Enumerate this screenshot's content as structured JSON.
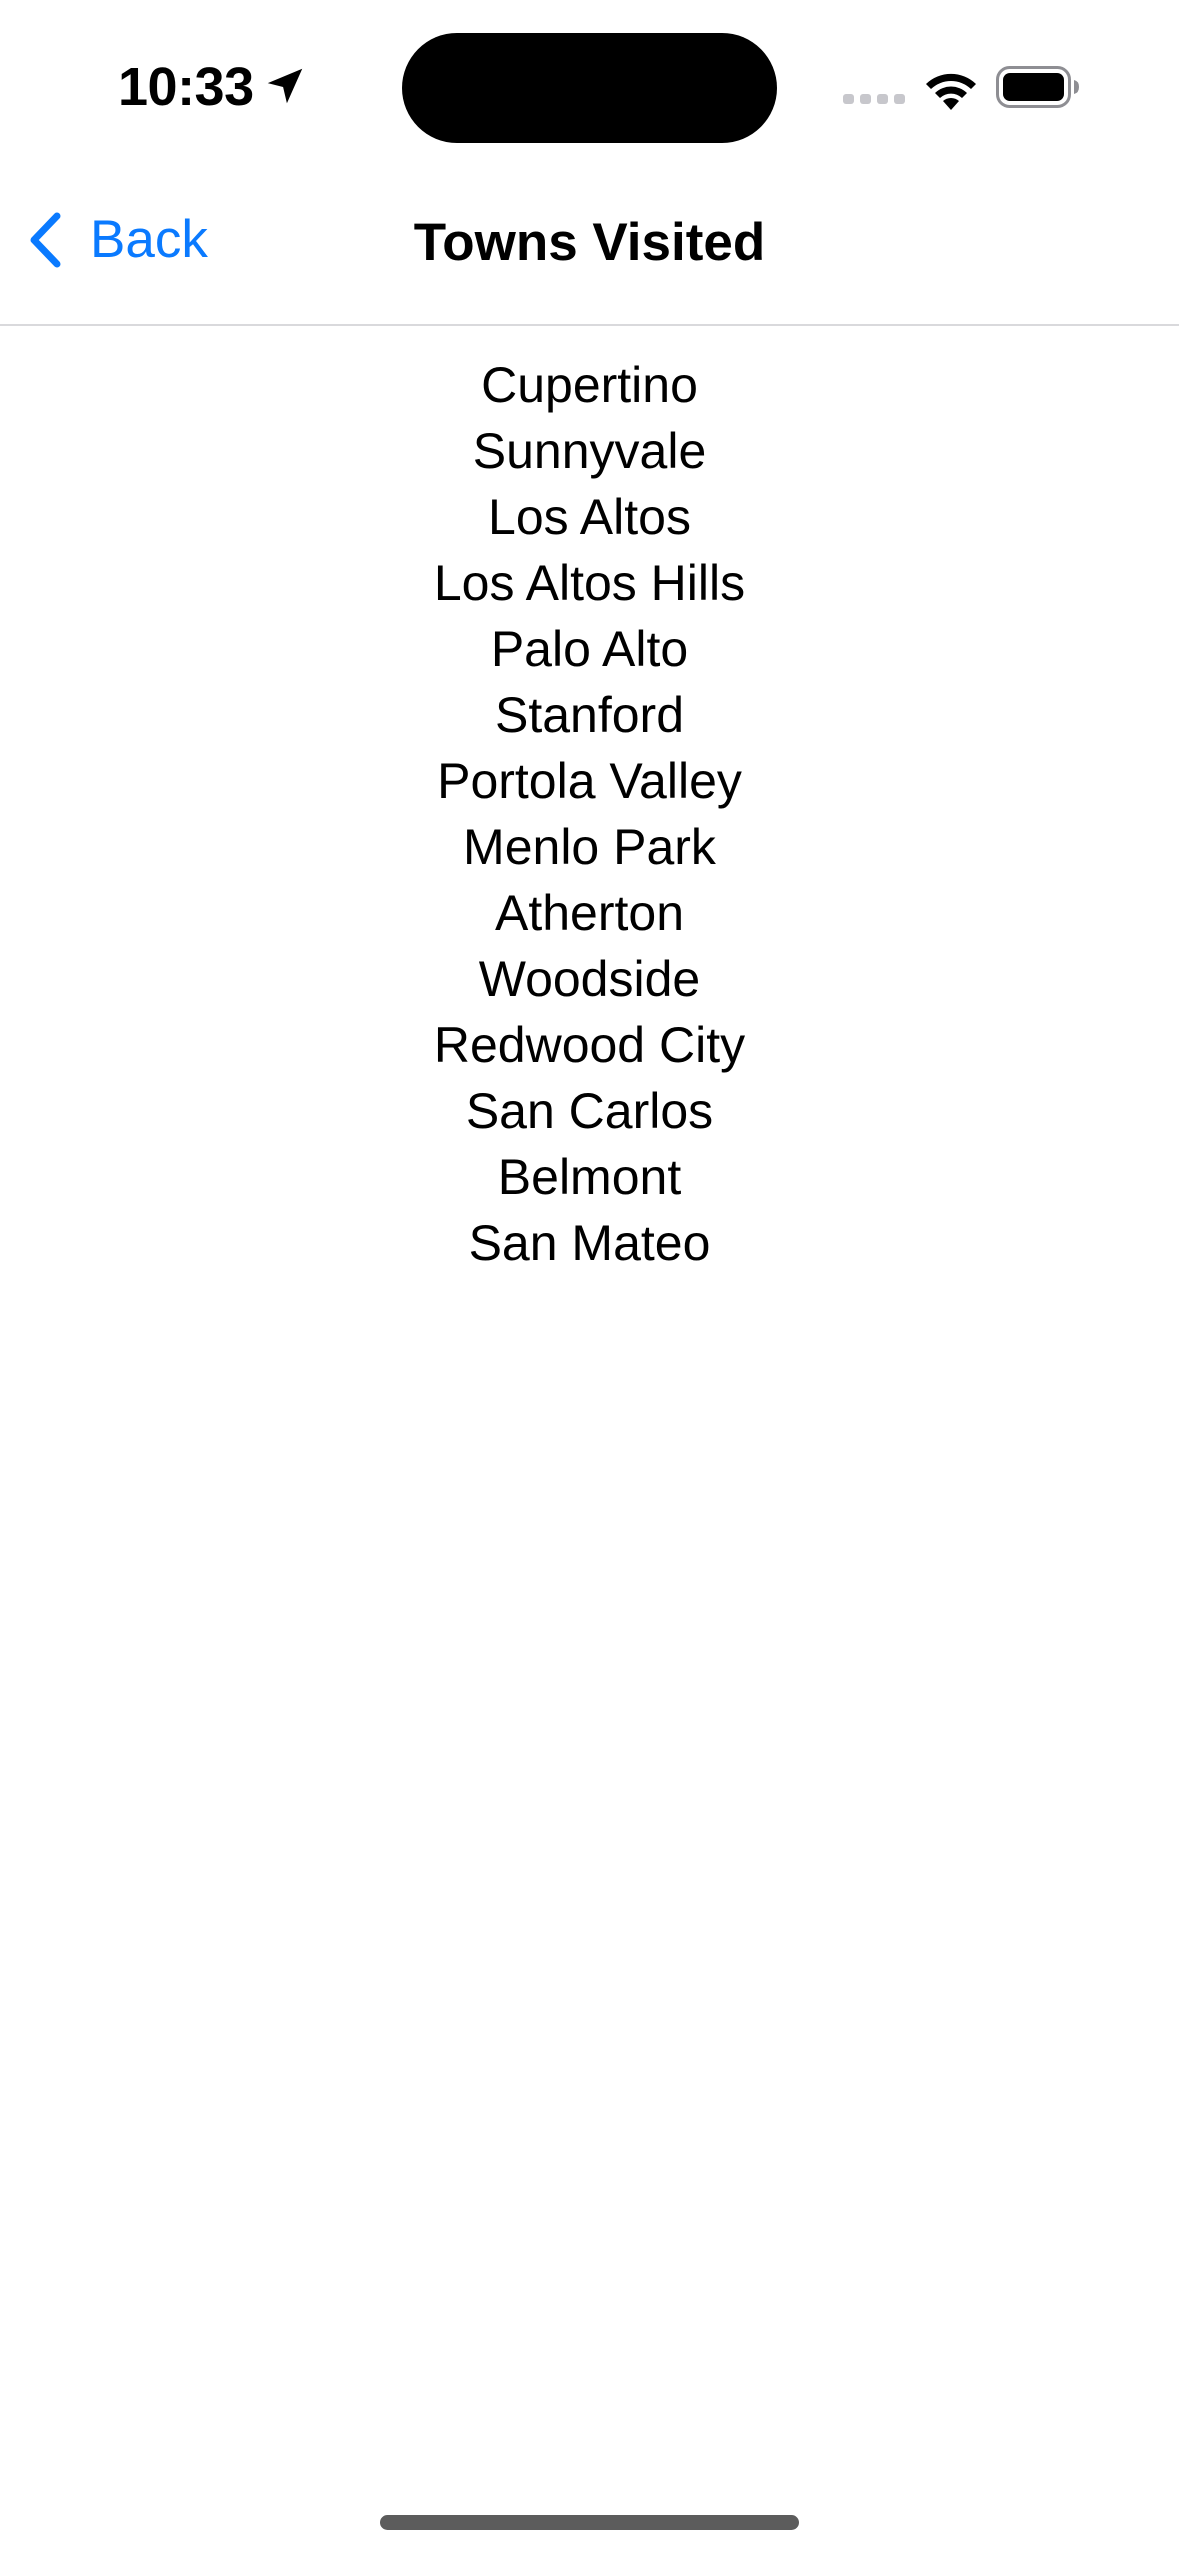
{
  "status_bar": {
    "time": "10:33",
    "icons": [
      "location-arrow-icon",
      "cellular-signal-icon",
      "wifi-icon",
      "battery-icon"
    ]
  },
  "nav": {
    "back_label": "Back",
    "title": "Towns Visited"
  },
  "towns": [
    "Cupertino",
    "Sunnyvale",
    "Los Altos",
    "Los Altos Hills",
    "Palo Alto",
    "Stanford",
    "Portola Valley",
    "Menlo Park",
    "Atherton",
    "Woodside",
    "Redwood City",
    "San Carlos",
    "Belmont",
    "San Mateo"
  ],
  "colors": {
    "accent": "#0a7aff",
    "text": "#000000",
    "background": "#ffffff",
    "separator": "#d9d9dc"
  }
}
